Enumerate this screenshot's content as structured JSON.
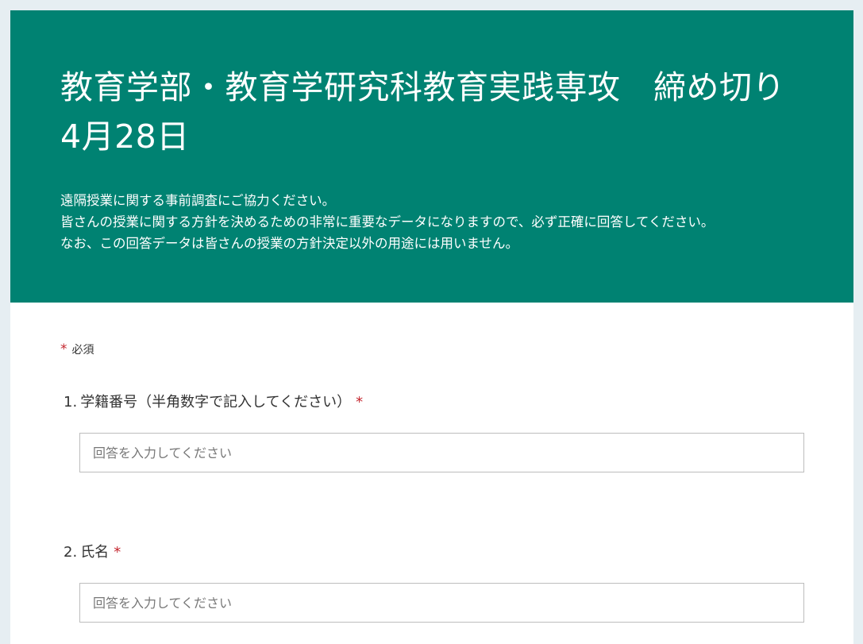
{
  "header": {
    "title": "教育学部・教育学研究科教育実践専攻　締め切り4月28日",
    "description_lines": [
      "遠隔授業に関する事前調査にご協力ください。",
      "皆さんの授業に関する方針を決めるための非常に重要なデータになりますので、必ず正確に回答してください。",
      "なお、この回答データは皆さんの授業の方針決定以外の用途には用いません。"
    ],
    "background_color": "#008272"
  },
  "required_note": {
    "star": "*",
    "label": "必須"
  },
  "questions": [
    {
      "number": "1.",
      "label": "学籍番号（半角数字で記入してください）",
      "required_star": "*",
      "placeholder": "回答を入力してください",
      "value": ""
    },
    {
      "number": "2.",
      "label": "氏名",
      "required_star": "*",
      "placeholder": "回答を入力してください",
      "value": ""
    }
  ],
  "colors": {
    "accent": "#008272",
    "required": "#c4262e",
    "page_background": "#e6eef2"
  }
}
